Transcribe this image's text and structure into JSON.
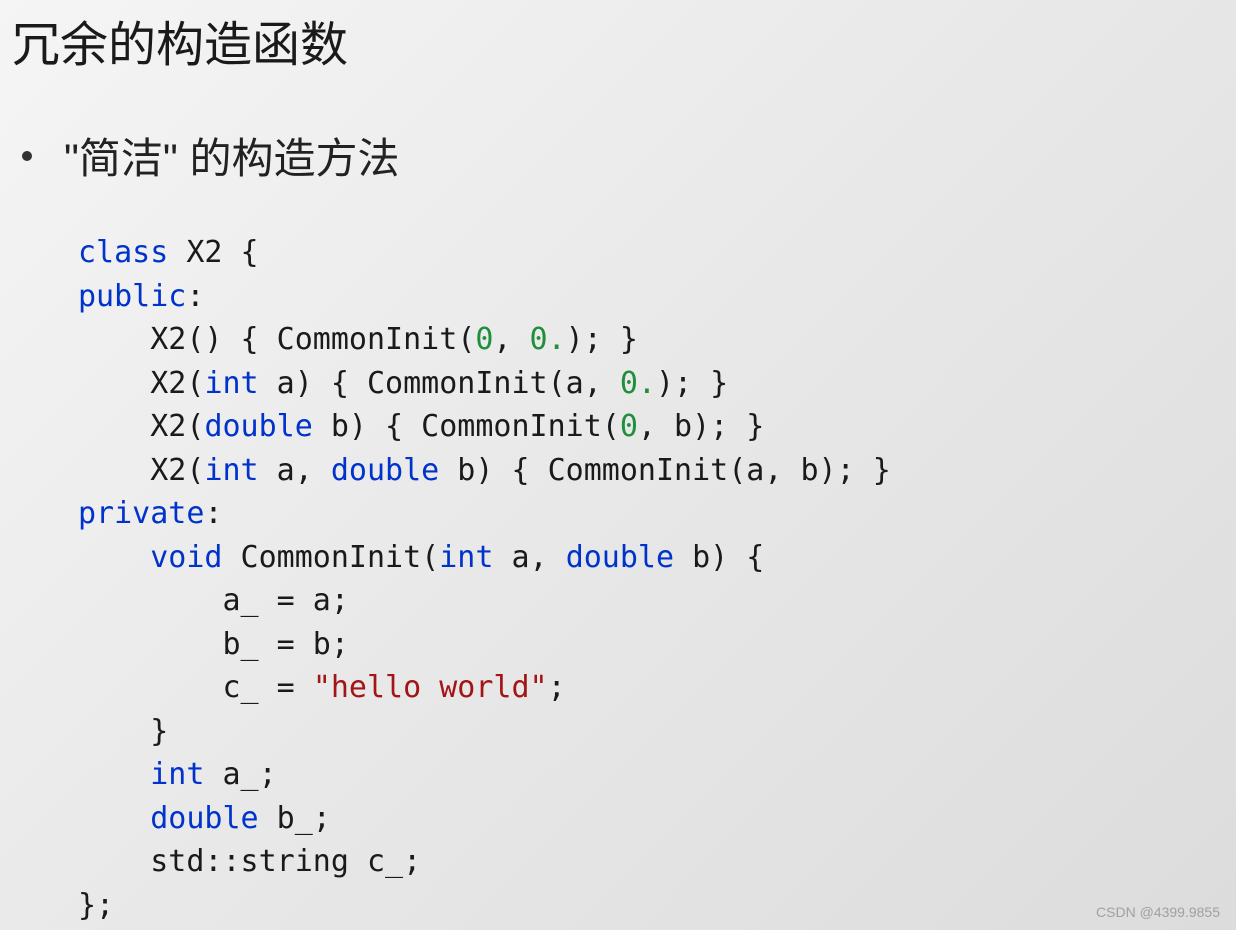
{
  "title": "冗余的构造函数",
  "bullet": "\"简洁\" 的构造方法",
  "code": {
    "kw_class": "class",
    "classname": " X2 {",
    "kw_public": "public",
    "colon": ":",
    "l3a": "    X2() { CommonInit(",
    "l3b": "0",
    "l3c": ", ",
    "l3d": "0.",
    "l3e": "); }",
    "l4a": "    X2(",
    "kw_int": "int",
    "l4b": " a) { CommonInit(a, ",
    "l4c": "0.",
    "l4d": "); }",
    "l5a": "    X2(",
    "kw_double": "double",
    "l5b": " b) { CommonInit(",
    "l5c": "0",
    "l5d": ", b); }",
    "l6a": "    X2(",
    "l6b": " a, ",
    "l6c": " b) { CommonInit(a, b); }",
    "kw_private": "private",
    "l8a": "    ",
    "kw_void": "void",
    "l8b": " CommonInit(",
    "l8c": " a, ",
    "l8d": " b) {",
    "l9": "        a_ = a;",
    "l10": "        b_ = b;",
    "l11a": "        c_ = ",
    "str_hello": "\"hello world\"",
    "l11b": ";",
    "l12": "    }",
    "l13a": "    ",
    "l13b": " a_;",
    "l14a": "    ",
    "l14b": " b_;",
    "l15": "    std::string c_;",
    "l16": "};"
  },
  "watermark": "CSDN @4399.9855"
}
